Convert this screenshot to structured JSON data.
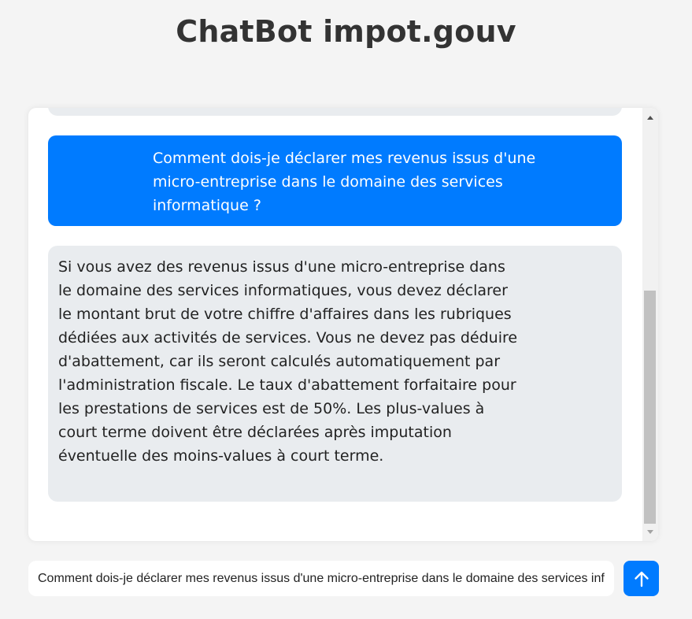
{
  "app": {
    "title": "ChatBot impot.gouv"
  },
  "conversation": {
    "messages": [
      {
        "role": "user",
        "text": "Comment dois-je déclarer mes revenus issus d'une micro-entreprise dans le domaine des services informatique ?"
      },
      {
        "role": "bot",
        "text": "Si vous avez des revenus issus d'une micro-entreprise dans le domaine des services informatiques, vous devez déclarer le montant brut de votre chiffre d'affaires dans les rubriques dédiées aux activités de services. Vous ne devez pas déduire d'abattement, car ils seront calculés automatiquement par l'administration fiscale. Le taux d'abattement forfaitaire pour les prestations de services est de 50%. Les plus-values à court terme doivent être déclarées après imputation éventuelle des moins-values à court terme."
      }
    ]
  },
  "composer": {
    "value": "Comment dois-je déclarer mes revenus issus d'une micro-entreprise dans le domaine des services informatique ?",
    "send_icon": "arrow-up-icon"
  },
  "colors": {
    "accent": "#007bff",
    "bot_bubble": "#e9ecef",
    "background": "#f4f4f4"
  }
}
